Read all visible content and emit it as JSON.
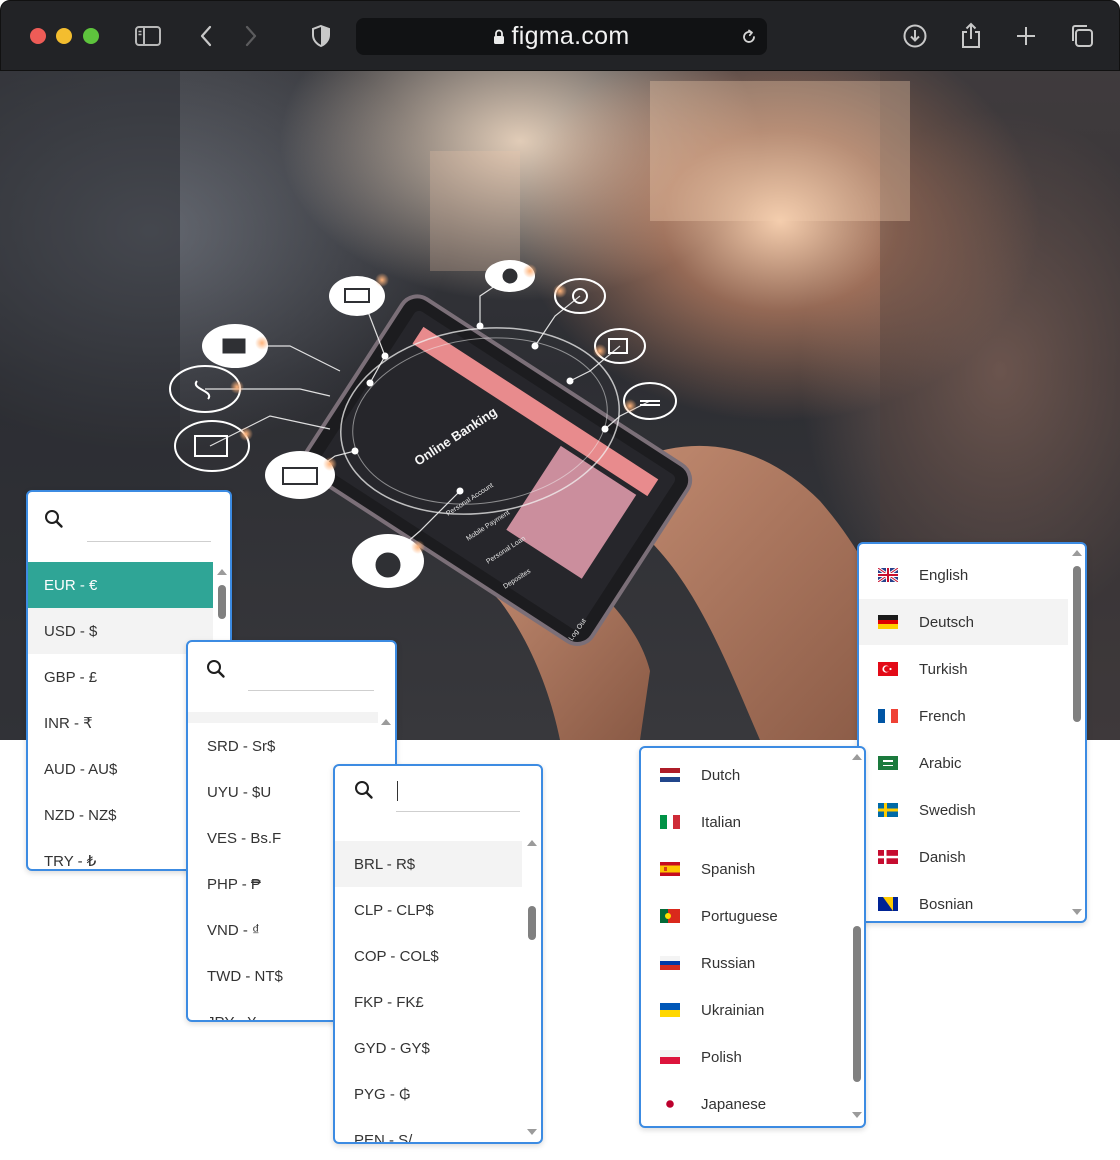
{
  "browser": {
    "url": "figma.com"
  },
  "currency_panel_1": {
    "items": [
      "EUR - €",
      "USD - $",
      "GBP - £",
      "INR - ₹",
      "AUD - AU$",
      "NZD - NZ$",
      "TRY - ₺"
    ],
    "selected": "EUR - €",
    "hovered": "USD - $"
  },
  "currency_panel_2": {
    "items": [
      "SRD - Sr$",
      "UYU - $U",
      "VES - Bs.F",
      "PHP - ₱",
      "VND - ₫",
      "TWD - NT$",
      "JPY - ¥"
    ]
  },
  "currency_panel_3": {
    "items": [
      "BRL - R$",
      "CLP - CLP$",
      "COP - COL$",
      "FKP - FK£",
      "GYD - GY$",
      "PYG - ₲",
      "PEN - S/."
    ],
    "hovered": "BRL - R$"
  },
  "language_panel_1": {
    "items": [
      {
        "label": "English",
        "flag": "uk-flag-icon"
      },
      {
        "label": "Deutsch",
        "flag": "germany-flag-icon"
      },
      {
        "label": "Turkish",
        "flag": "turkey-flag-icon"
      },
      {
        "label": "French",
        "flag": "france-flag-icon"
      },
      {
        "label": "Arabic",
        "flag": "saudi-flag-icon"
      },
      {
        "label": "Swedish",
        "flag": "sweden-flag-icon"
      },
      {
        "label": "Danish",
        "flag": "denmark-flag-icon"
      },
      {
        "label": "Bosnian",
        "flag": "bosnia-flag-icon"
      }
    ],
    "hovered": "Deutsch"
  },
  "language_panel_2": {
    "items": [
      {
        "label": "Dutch",
        "flag": "netherlands-flag-icon"
      },
      {
        "label": "Italian",
        "flag": "italy-flag-icon"
      },
      {
        "label": "Spanish",
        "flag": "spain-flag-icon"
      },
      {
        "label": "Portuguese",
        "flag": "portugal-flag-icon"
      },
      {
        "label": "Russian",
        "flag": "russia-flag-icon"
      },
      {
        "label": "Ukrainian",
        "flag": "ukraine-flag-icon"
      },
      {
        "label": "Polish",
        "flag": "poland-flag-icon"
      },
      {
        "label": "Japanese",
        "flag": "japan-flag-icon"
      }
    ]
  },
  "tablet_screen": {
    "title": "Online Banking",
    "menu": [
      "Personal Account",
      "Mobile Payment",
      "Personal Loan",
      "Deposites"
    ],
    "logout": "Log Out"
  },
  "colors": {
    "accent": "#2fa596",
    "panel_border": "#3c8be2",
    "browser_bar": "#222326"
  }
}
